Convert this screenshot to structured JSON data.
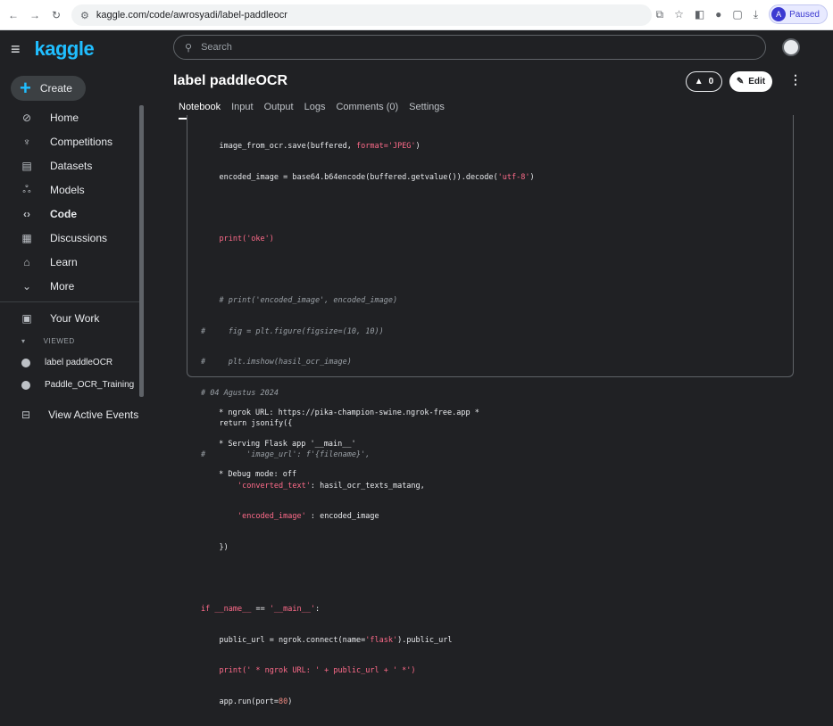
{
  "browser": {
    "url": "kaggle.com/code/awrosyadi/label-paddleocr",
    "profile_status": "Paused",
    "profile_initial": "A"
  },
  "app": {
    "logo": "kaggle",
    "search_placeholder": "Search",
    "create_label": "Create"
  },
  "sidebar": {
    "items": [
      {
        "label": "Home",
        "icon": "compass-icon"
      },
      {
        "label": "Competitions",
        "icon": "trophy-icon"
      },
      {
        "label": "Datasets",
        "icon": "table-icon"
      },
      {
        "label": "Models",
        "icon": "models-icon"
      },
      {
        "label": "Code",
        "icon": "code-icon"
      },
      {
        "label": "Discussions",
        "icon": "discussion-icon"
      },
      {
        "label": "Learn",
        "icon": "learn-icon"
      },
      {
        "label": "More",
        "icon": "chevron-down-icon"
      }
    ],
    "your_work": "Your Work",
    "viewed_label": "VIEWED",
    "recent": [
      "label paddleOCR",
      "Paddle_OCR_Training"
    ],
    "view_active_events": "View Active Events"
  },
  "notebook": {
    "title": "label paddleOCR",
    "vote_count": "0",
    "edit_label": "Edit",
    "tabs": [
      "Notebook",
      "Input",
      "Output",
      "Logs",
      "Comments (0)",
      "Settings"
    ]
  },
  "code": {
    "l1": "image_from_ocr.save(buffered, ",
    "l1b": "format='JPEG'",
    "l1c": ")",
    "l2": "encoded_image = base64.b64encode(buffered.getvalue()).decode(",
    "l2b": "'utf-8'",
    "l2c": ")",
    "l3": "print('oke')",
    "l4": "# print('encoded_image', encoded_image)",
    "l5": "#     fig = plt.figure(figsize=(10, 10))",
    "l6": "#     plt.imshow(hasil_ocr_image)",
    "l7": "# 04 Agustus 2024",
    "l8": "return jsonify({",
    "l9": "#         'image_url': f'{filename}',",
    "l10a": "'converted_text'",
    "l10b": ": hasil_ocr_texts_matang,",
    "l11a": "'encoded_image'",
    "l11b": " : encoded_image",
    "l12": "})",
    "l13a": "if",
    "l13b": "__name__",
    "l13c": " == ",
    "l13d": "'__main__'",
    "l13e": ":",
    "l14a": "public_url = ngrok.connect(name=",
    "l14b": "'flask'",
    "l14c": ").public_url",
    "l15": "print(' * ngrok URL: ' + public_url + ' *')",
    "l16a": "app.run(port=",
    "l16b": "80",
    "l16c": ")"
  },
  "output": [
    " * ngrok URL: https://pika-champion-swine.ngrok-free.app *",
    " * Serving Flask app '__main__'",
    " * Debug mode: off"
  ]
}
